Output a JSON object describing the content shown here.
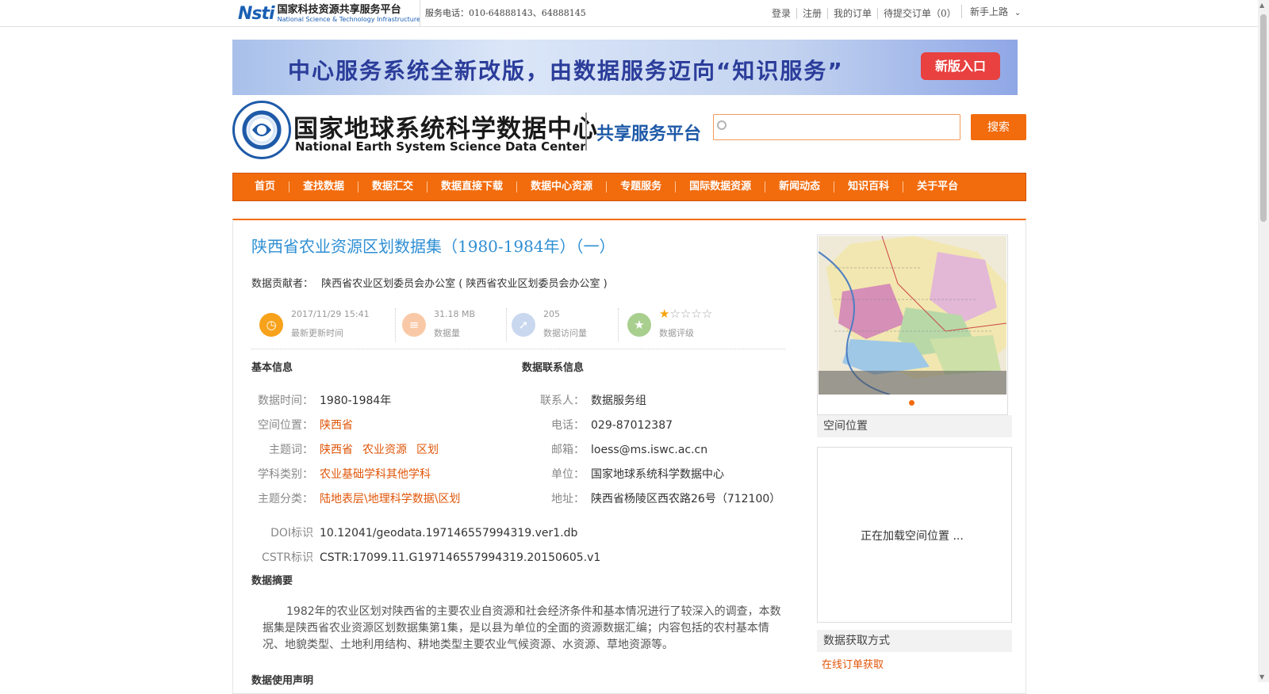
{
  "topbar": {
    "logo_mark": "Nsti",
    "logo_cn": "国家科技资源共享服务平台",
    "logo_en": "National Science & Technology Infrastructure",
    "phone": "服务电话：010-64888143、64888145",
    "links": [
      "登录",
      "注册",
      "我的订单",
      "待提交订单（0）"
    ],
    "newbie": "新手上路"
  },
  "banner": {
    "text": "中心服务系统全新改版，由数据服务迈向“知识服务”",
    "button": "新版入口"
  },
  "header": {
    "logo_cn": "国家地球系统科学数据中心",
    "logo_en": "National Earth System Science Data Center",
    "subtitle": "共享服务平台",
    "search_placeholder": "",
    "search_button": "搜索"
  },
  "nav": [
    "首页",
    "查找数据",
    "数据汇交",
    "数据直接下载",
    "数据中心资源",
    "专题服务",
    "国际数据资源",
    "新闻动态",
    "知识百科",
    "关于平台"
  ],
  "dataset": {
    "title": "陕西省农业资源区划数据集（1980-1984年）（一）",
    "contributor_label": "数据贡献者：",
    "contributor": "陕西省农业区划委员会办公室 ( 陕西省农业区划委员会办公室 )",
    "stats": {
      "update_time": "2017/11/29 15:41",
      "update_label": "最新更新时间",
      "size": "31.18 MB",
      "size_label": "数据量",
      "visits": "205",
      "visits_label": "数据访问量",
      "rating_stars": 1,
      "rating_max": 5,
      "rating_label": "数据评级"
    },
    "basic_info_title": "基本信息",
    "basic_info": {
      "time_label": "数据时间：",
      "time": "1980-1984年",
      "location_label": "空间位置：",
      "location": "陕西省",
      "keywords_label": "主题词：",
      "keywords": [
        "陕西省",
        "农业资源",
        "区划"
      ],
      "discipline_label": "学科类别：",
      "discipline": "农业基础学科其他学科",
      "category_label": "主题分类：",
      "category": "陆地表层\\地理科学数据\\区划"
    },
    "contact_title": "数据联系信息",
    "contact": {
      "person_label": "联系人：",
      "person": "数据服务组",
      "phone_label": "电话：",
      "phone": "029-87012387",
      "email_label": "邮箱：",
      "email": "loess@ms.iswc.ac.cn",
      "org_label": "单位：",
      "org": "国家地球系统科学数据中心",
      "address_label": "地址：",
      "address": "陕西省杨陵区西农路26号（712100）"
    },
    "doi_label": "DOI标识",
    "doi": "10.12041/geodata.197146557994319.ver1.db",
    "cstr_label": "CSTR标识",
    "cstr": "CSTR:17099.11.G197146557994319.20150605.v1",
    "abstract_title": "数据摘要",
    "abstract": "1982年的农业区划对陕西省的主要农业自资源和社会经济条件和基本情况进行了较深入的调查，本数据集是陕西省农业资源区划数据集第1集，是以县为单位的全面的资源数据汇编；内容包括的农村基本情况、地貌类型、土地利用结构、耕地类型主要农业气候资源、水资源、草地资源等。",
    "usage_title": "数据使用声明"
  },
  "sidebar": {
    "spatial_title": "空间位置",
    "loading": "正在加载空间位置 ...",
    "access_title": "数据获取方式",
    "order_link": "在线订单获取"
  }
}
